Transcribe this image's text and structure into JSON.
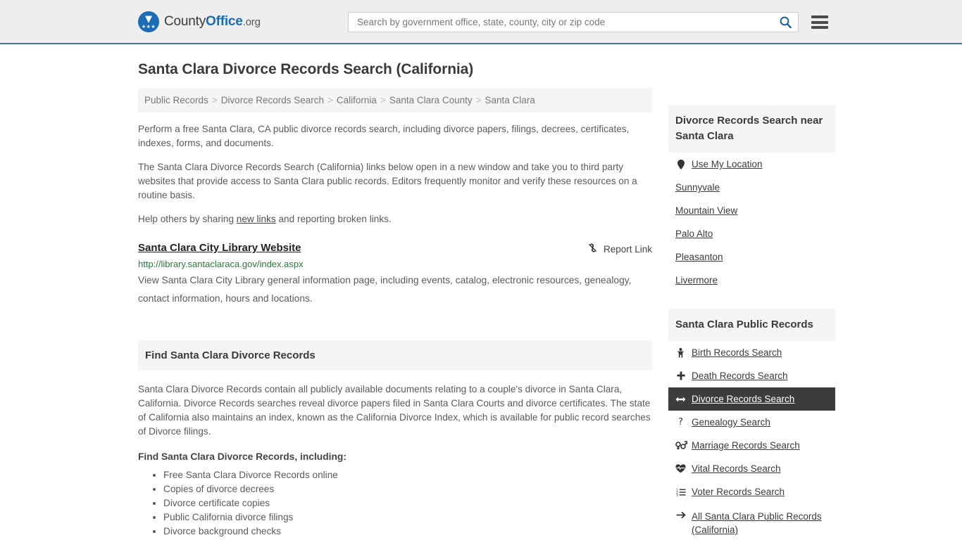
{
  "header": {
    "logo": {
      "part1": "County",
      "part2": "Office",
      "part3": ".org",
      "icon": "eagle-shield-logo"
    },
    "search": {
      "placeholder": "Search by government office, state, county, city or zip code",
      "value": "",
      "search_icon": "search-icon"
    },
    "menu_icon": "hamburger-menu-icon",
    "accent_color": "#3a77a8"
  },
  "page_title": "Santa Clara Divorce Records Search (California)",
  "breadcrumb": {
    "separator": ">",
    "items": [
      {
        "label": "Public Records"
      },
      {
        "label": "Divorce Records Search"
      },
      {
        "label": "California"
      },
      {
        "label": "Santa Clara County"
      },
      {
        "label": "Santa Clara"
      }
    ]
  },
  "intro": {
    "p1": "Perform a free Santa Clara, CA public divorce records search, including divorce papers, filings, decrees, certificates, indexes, forms, and documents.",
    "p2": "The Santa Clara Divorce Records Search (California) links below open in a new window and take you to third party websites that provide access to Santa Clara public records. Editors frequently monitor and verify these resources on a routine basis.",
    "p3_before": "Help others by sharing ",
    "p3_link": "new links",
    "p3_after": " and reporting broken links."
  },
  "result": {
    "title": "Santa Clara City Library Website",
    "url": "http://library.santaclaraca.gov/index.aspx",
    "description": "View Santa Clara City Library general information page, including events, catalog, electronic resources, genealogy, contact information, hours and locations.",
    "report_label": "Report Link",
    "report_icon": "broken-link-icon"
  },
  "find_section": {
    "heading": "Find Santa Clara Divorce Records",
    "body": "Santa Clara Divorce Records contain all publicly available documents relating to a couple's divorce in Santa Clara, California. Divorce Records searches reveal divorce papers filed in Santa Clara Courts and divorce certificates. The state of California also maintains an index, known as the California Divorce Index, which is available for public record searches of Divorce filings.",
    "sub_heading": "Find Santa Clara Divorce Records, including:",
    "bullets": [
      "Free Santa Clara Divorce Records online",
      "Copies of divorce decrees",
      "Divorce certificate copies",
      "Public California divorce filings",
      "Divorce background checks"
    ]
  },
  "sidebar": {
    "nearby": {
      "heading": "Divorce Records Search near Santa Clara",
      "items": [
        {
          "label": "Use My Location",
          "icon": "map-pin-icon"
        },
        {
          "label": "Sunnyvale",
          "icon": ""
        },
        {
          "label": "Mountain View",
          "icon": ""
        },
        {
          "label": "Palo Alto",
          "icon": ""
        },
        {
          "label": "Pleasanton",
          "icon": ""
        },
        {
          "label": "Livermore",
          "icon": ""
        }
      ]
    },
    "public_records": {
      "heading": "Santa Clara Public Records",
      "active_index": 2,
      "active_color": "#3c3c3c",
      "items": [
        {
          "label": "Birth Records Search",
          "icon": "baby-icon"
        },
        {
          "label": "Death Records Search",
          "icon": "cross-icon"
        },
        {
          "label": "Divorce Records Search",
          "icon": "arrows-left-right-icon"
        },
        {
          "label": "Genealogy Search",
          "icon": "question-mark-icon"
        },
        {
          "label": "Marriage Records Search",
          "icon": "venus-mars-icon"
        },
        {
          "label": "Vital Records Search",
          "icon": "heartbeat-icon"
        },
        {
          "label": "Voter Records Search",
          "icon": "ordered-list-icon"
        },
        {
          "label": "All Santa Clara Public Records (California)",
          "icon": "arrow-right-icon"
        }
      ]
    }
  }
}
